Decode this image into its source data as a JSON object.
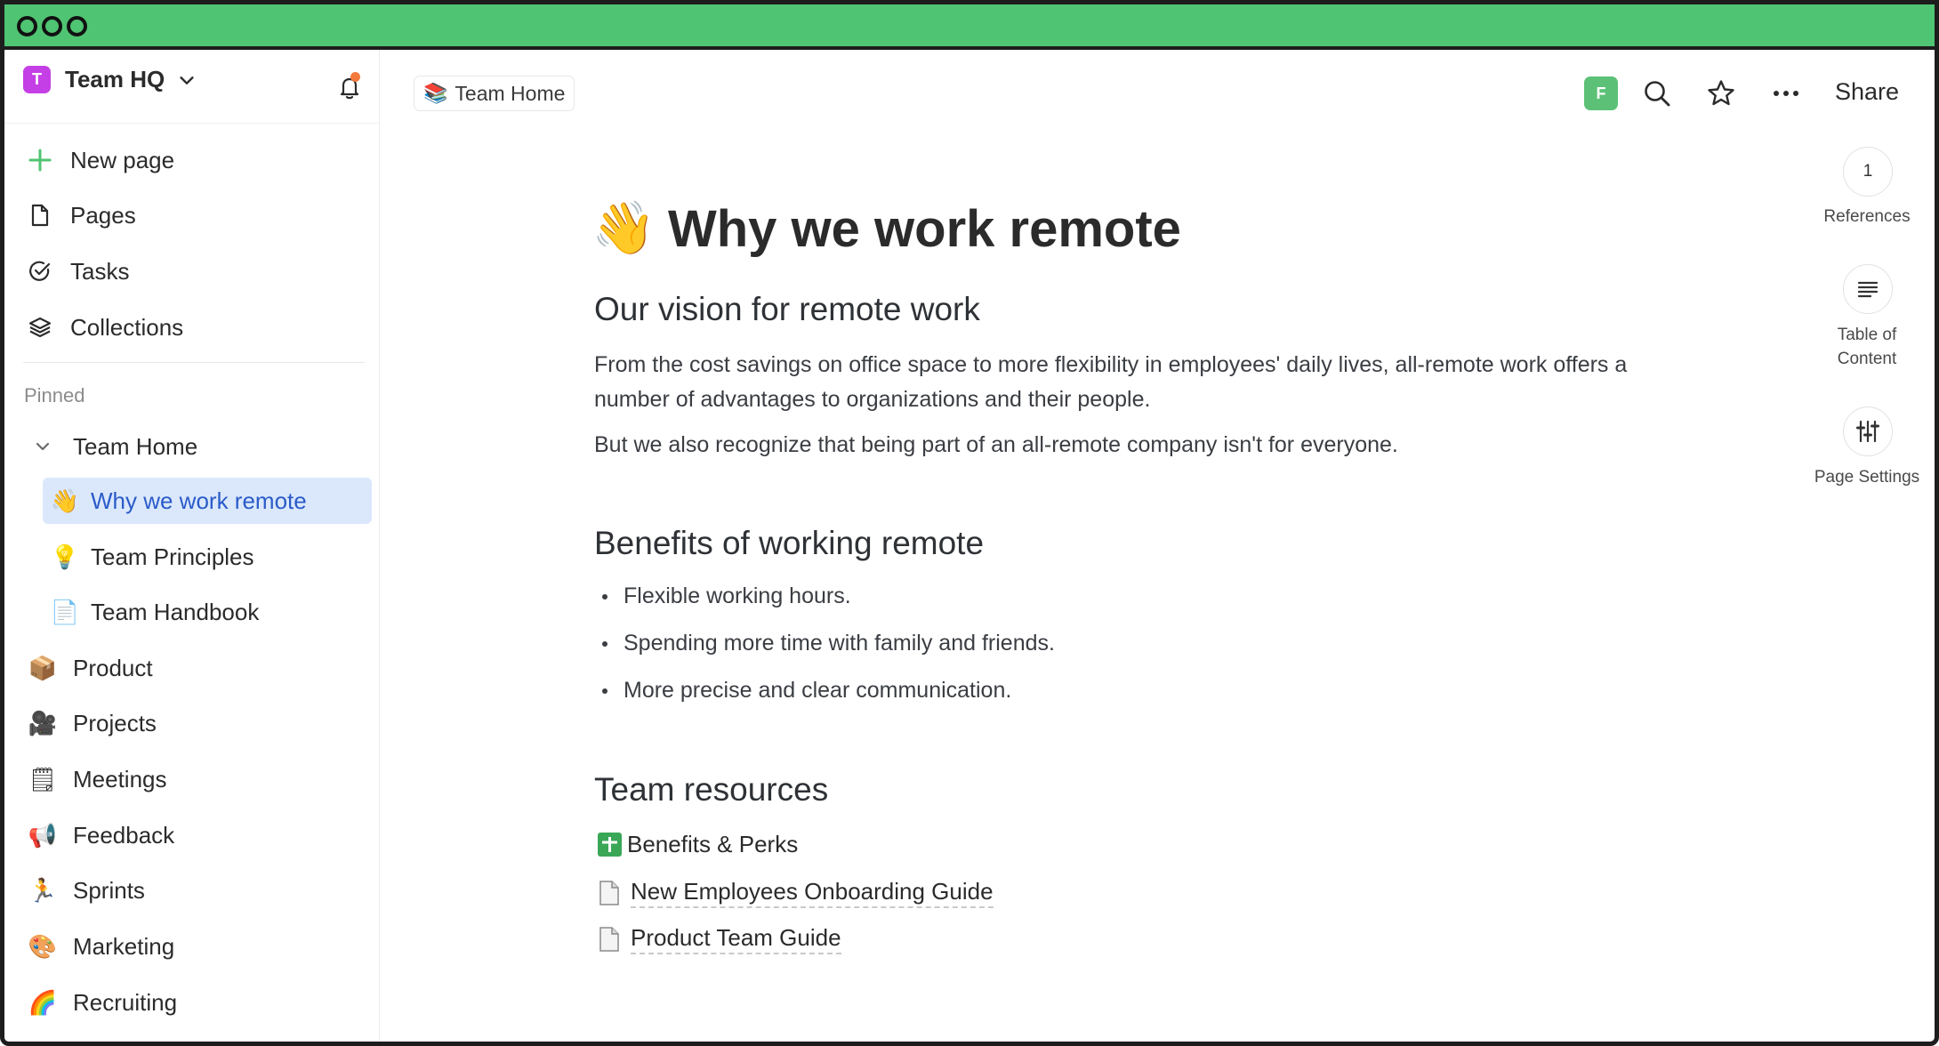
{
  "workspace": {
    "avatar_letter": "T",
    "name": "Team HQ"
  },
  "sidebar": {
    "nav": [
      {
        "label": "New page",
        "icon": "plus-icon"
      },
      {
        "label": "Pages",
        "icon": "page-icon"
      },
      {
        "label": "Tasks",
        "icon": "check-circle-icon"
      },
      {
        "label": "Collections",
        "icon": "layers-icon"
      }
    ],
    "pinned_label": "Pinned",
    "tree": [
      {
        "label": "Team Home",
        "icon": "chevron-down-icon"
      },
      {
        "label": "Why we work remote",
        "emoji": "👋",
        "active": true
      },
      {
        "label": "Team Principles",
        "emoji": "💡"
      },
      {
        "label": "Team Handbook",
        "emoji": "📄"
      },
      {
        "label": "Product",
        "emoji": "📦"
      },
      {
        "label": "Projects",
        "emoji": "🎥"
      },
      {
        "label": "Meetings",
        "emoji": "🗒"
      },
      {
        "label": "Feedback",
        "emoji": "📢"
      },
      {
        "label": "Sprints",
        "emoji": "🏃"
      },
      {
        "label": "Marketing",
        "emoji": "🎨"
      },
      {
        "label": "Recruiting",
        "emoji": "🌈"
      }
    ]
  },
  "topbar": {
    "breadcrumb": "Team Home",
    "breadcrumb_emoji": "📚",
    "user_avatar": "F",
    "share_label": "Share"
  },
  "page": {
    "emoji": "👋",
    "title": "Why we work remote",
    "sections": {
      "vision_heading": "Our vision for remote work",
      "vision_p1": "From the cost savings on office space to more flexibility in employees' daily lives, all-remote work offers a number of advantages to organizations and their people.",
      "vision_p2": "But we also recognize that being part of an all-remote company isn't for everyone.",
      "benefits_heading": "Benefits of working remote",
      "benefits": [
        "Flexible working hours.",
        "Spending more time with family and friends.",
        "More precise and clear communication."
      ],
      "resources_heading": "Team resources",
      "resources": [
        "Benefits & Perks",
        "New Employees Onboarding Guide",
        "Product Team Guide"
      ]
    }
  },
  "rail": {
    "references_count": "1",
    "references_label": "References",
    "toc_label": "Table of Content",
    "settings_label": "Page Settings"
  },
  "colors": {
    "titlebar": "#4fc472",
    "workspace_avatar": "#c43fe5",
    "active_bg": "#dbe8fb",
    "active_text": "#2a5bc9",
    "user_avatar": "#5cc176",
    "notification_dot": "#f47a3c"
  }
}
